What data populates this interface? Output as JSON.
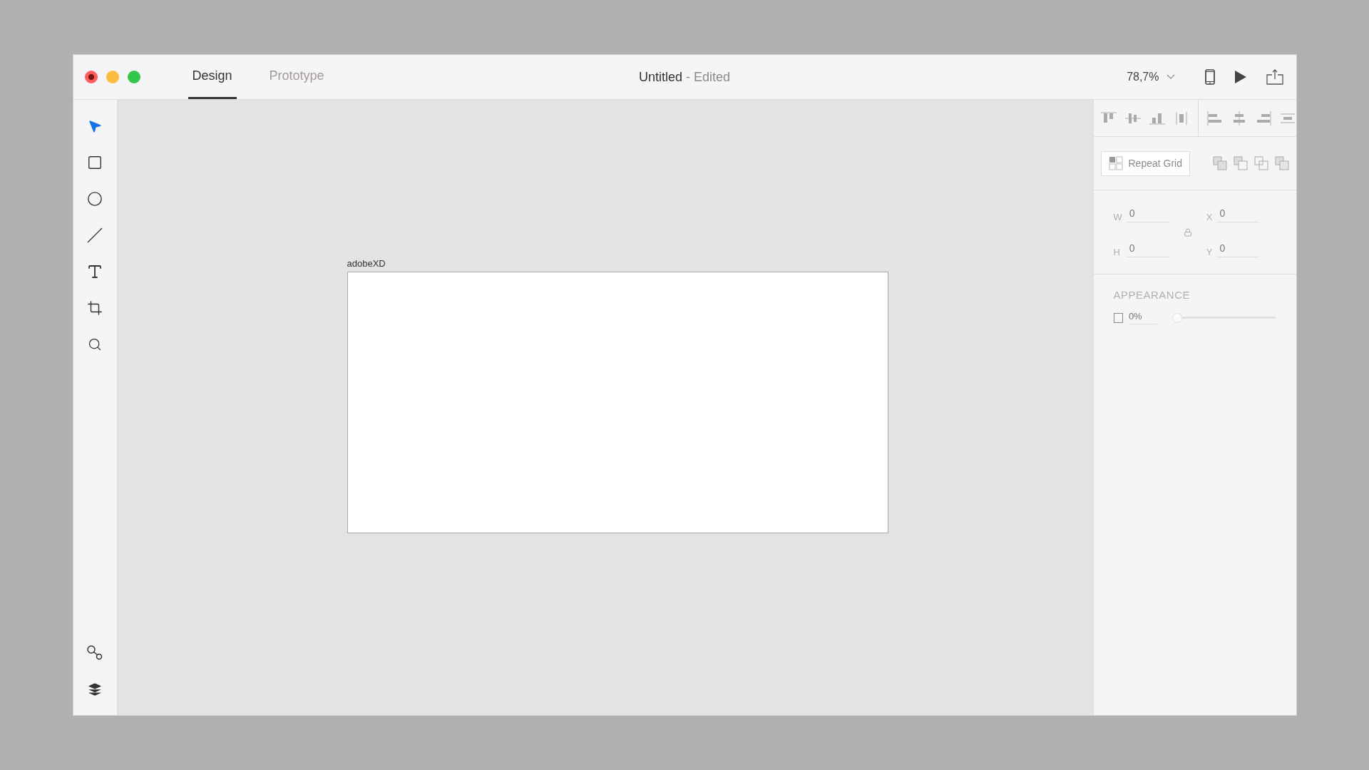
{
  "window": {
    "title": "Untitled",
    "status": "- Edited"
  },
  "tabs": [
    {
      "label": "Design",
      "selected": true
    },
    {
      "label": "Prototype",
      "selected": false
    }
  ],
  "zoom": {
    "value": "78,7%"
  },
  "tools": [
    {
      "kind": "select",
      "selected": true
    },
    {
      "kind": "rectangle",
      "selected": false
    },
    {
      "kind": "ellipse",
      "selected": false
    },
    {
      "kind": "line",
      "selected": false
    },
    {
      "kind": "text",
      "selected": false
    },
    {
      "kind": "artboard",
      "selected": false
    },
    {
      "kind": "zoom",
      "selected": false
    }
  ],
  "artboard": {
    "name": "adobeXD"
  },
  "inspector": {
    "repeat_grid": "Repeat Grid",
    "fields": [
      {
        "label": "W",
        "value": "0"
      },
      {
        "label": "X",
        "value": "0"
      },
      {
        "label": "H",
        "value": "0"
      },
      {
        "label": "Y",
        "value": "0"
      }
    ],
    "appearance": {
      "heading": "APPEARANCE",
      "checked": false,
      "opacity": "0%",
      "level": 0
    }
  }
}
